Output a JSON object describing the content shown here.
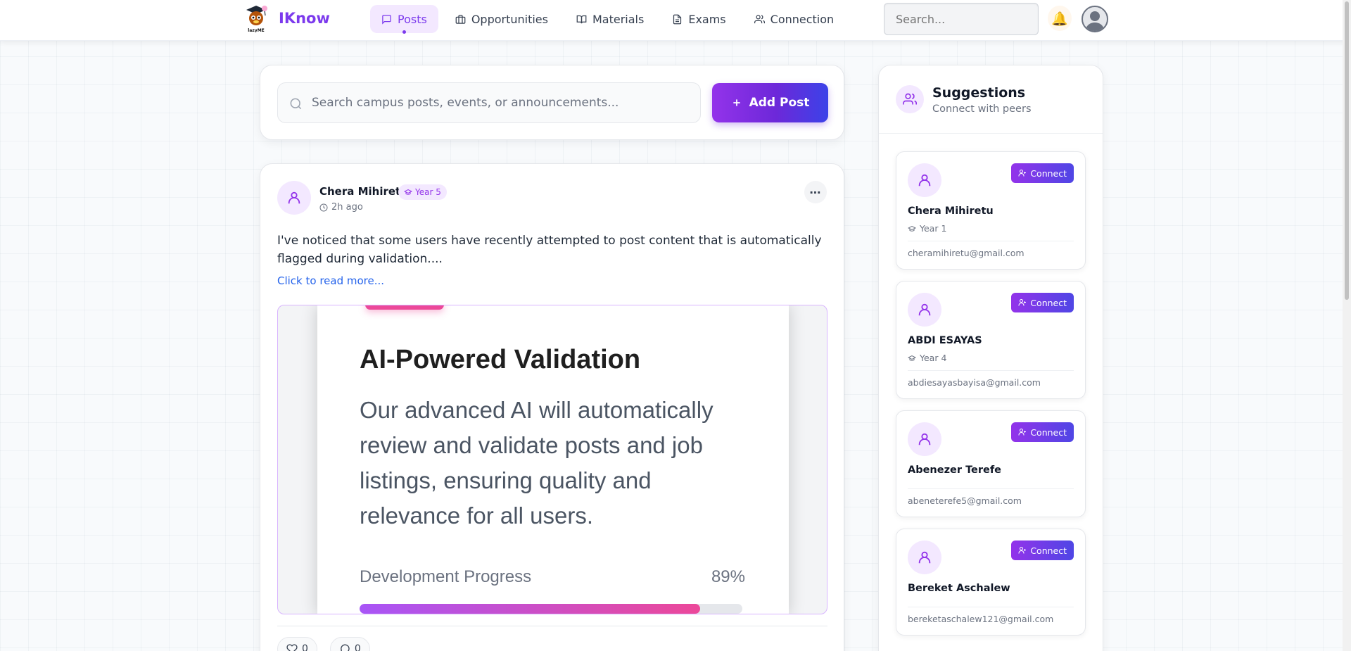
{
  "brand": {
    "name": "IKnow",
    "logo_label": "lazyME"
  },
  "nav": [
    {
      "label": "Posts",
      "icon": "message-square-icon",
      "active": true
    },
    {
      "label": "Opportunities",
      "icon": "briefcase-icon"
    },
    {
      "label": "Materials",
      "icon": "book-open-icon"
    },
    {
      "label": "Exams",
      "icon": "file-text-icon"
    },
    {
      "label": "Connection",
      "icon": "users-icon"
    }
  ],
  "header": {
    "search_placeholder": "Search...",
    "notification_icon": "bell-icon"
  },
  "feed": {
    "search_placeholder": "Search campus posts, events, or announcements...",
    "add_post_label": "Add Post"
  },
  "post": {
    "author": "Chera Mihiretu",
    "year": "Year 5",
    "time": "2h ago",
    "text": "I've noticed that some users have recently attempted to post content that is automatically flagged during validation....",
    "read_more": "Click to read more...",
    "image": {
      "title": "AI-Powered Validation",
      "body": "Our advanced AI will automatically review and validate posts and job listings, ensuring quality and relevance for all users.",
      "progress_label": "Development Progress",
      "progress_value": "89%",
      "progress_fraction": 0.89
    },
    "likes": "0",
    "comments": "0"
  },
  "suggestions": {
    "title": "Suggestions",
    "subtitle": "Connect with peers",
    "connect_label": "Connect",
    "people": [
      {
        "name": "Chera Mihiretu",
        "year": "Year 1",
        "email": "cheramihiretu@gmail.com"
      },
      {
        "name": "ABDI ESAYAS",
        "year": "Year 4",
        "email": "abdiesayasbayisa@gmail.com"
      },
      {
        "name": "Abenezer Terefe",
        "year": "",
        "email": "abeneterefe5@gmail.com"
      },
      {
        "name": "Bereket Aschalew",
        "year": "",
        "email": "bereketaschalew121@gmail.com"
      }
    ]
  },
  "colors": {
    "accent": "#7c3aed",
    "accent_light": "#f3e8ff",
    "link": "#2563eb",
    "pink": "#ec4899"
  }
}
